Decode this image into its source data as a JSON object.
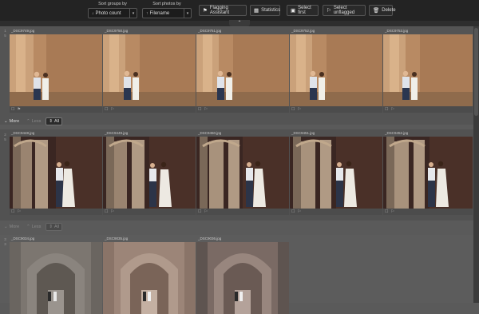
{
  "toolbar": {
    "sort_groups_label": "Sort groups by",
    "sort_groups_value": "Photo count",
    "sort_photos_label": "Sort photos by",
    "sort_photos_value": "Filename",
    "buttons": [
      {
        "label": "Flagging Assistant",
        "icon": "flag-icon"
      },
      {
        "label": "Statistics",
        "icon": "chart-icon"
      },
      {
        "label": "Select first",
        "icon": "select-first-icon"
      },
      {
        "label": "Select unflagged",
        "icon": "flag-outline-icon"
      },
      {
        "label": "Delete",
        "icon": "trash-icon"
      }
    ]
  },
  "groups": [
    {
      "number": "1",
      "count": "5",
      "photos": [
        "_DSC9749.jpg",
        "_DSC9750.jpg",
        "_DSC9751.jpg",
        "_DSC9752.jpg",
        "_DSC9753.jpg"
      ],
      "actions": {
        "more": "More",
        "less": "Less",
        "all": "All"
      }
    },
    {
      "number": "2",
      "count": "5",
      "photos": [
        "_DSC9448.jpg",
        "_DSC9449.jpg",
        "_DSC9450.jpg",
        "_DSC9451.jpg",
        "_DSC9452.jpg"
      ],
      "actions": {
        "more": "More",
        "less": "Less",
        "all": "All"
      }
    },
    {
      "number": "3",
      "count": "3",
      "photos": [
        "_DSC9034.jpg",
        "_DSC9035.jpg",
        "_DSC9036.jpg"
      ]
    }
  ],
  "colors": {
    "toolbar_bg": "#232323",
    "page_bg": "#5a5a5a",
    "card_bg": "#4c4c4c"
  }
}
